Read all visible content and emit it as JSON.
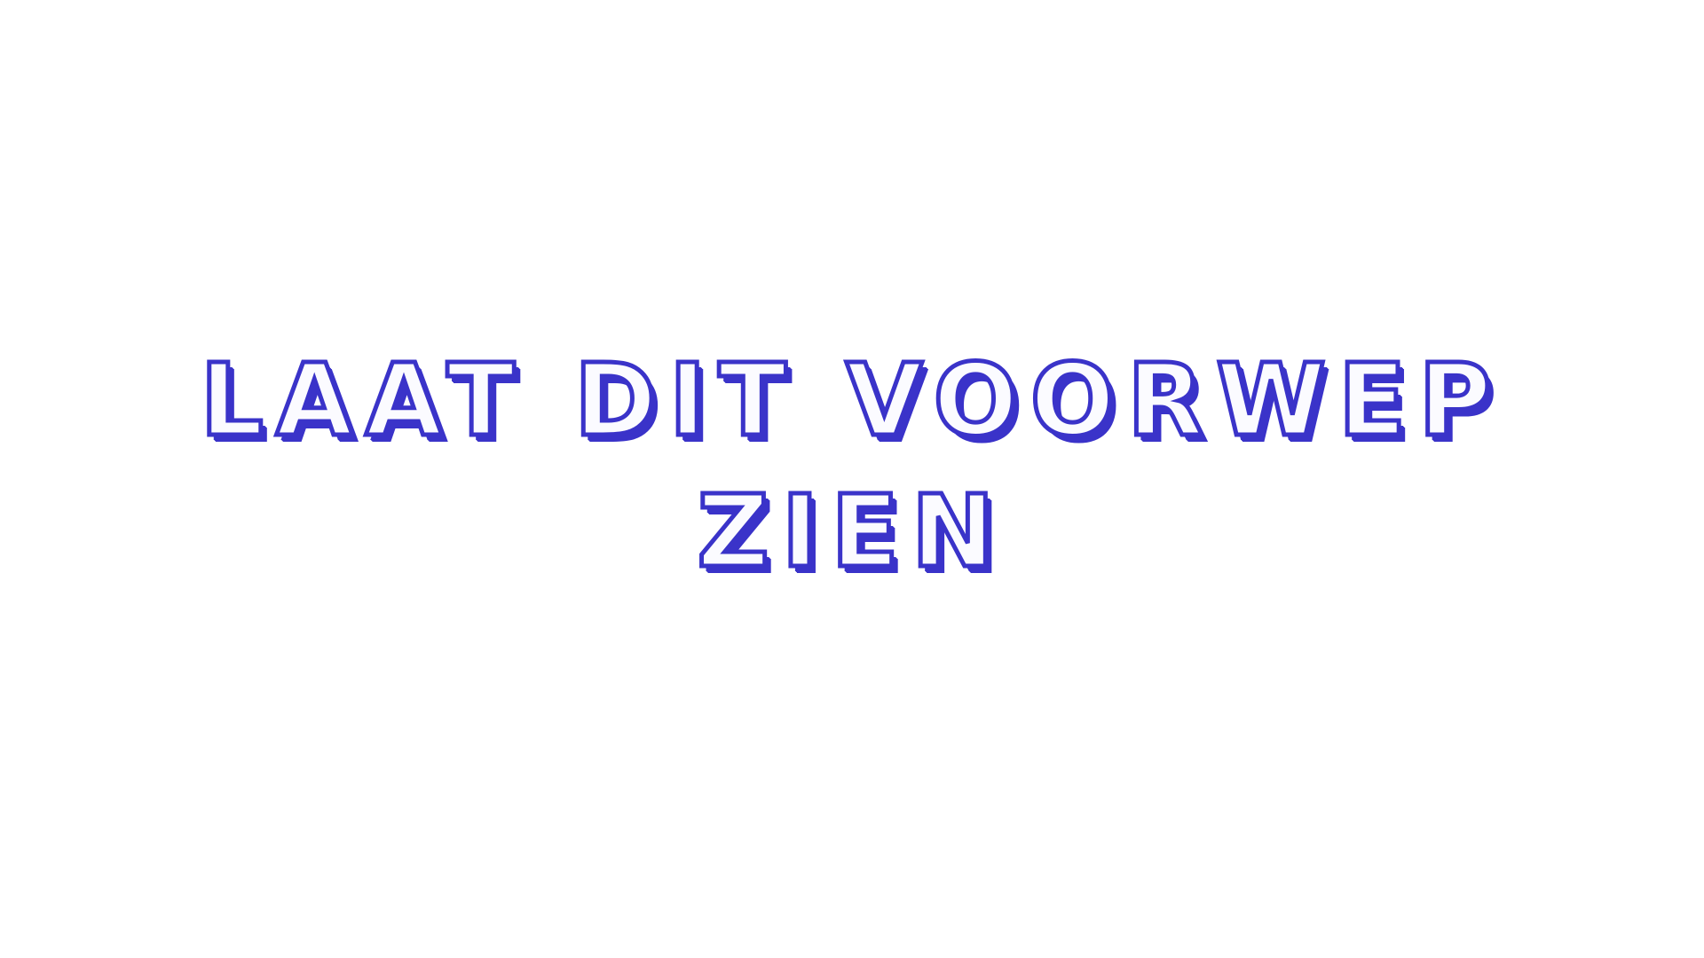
{
  "preview": {
    "line1": "laat dit voorwep",
    "line2": "zien"
  },
  "colors": {
    "background": "#ffffff",
    "text_outline": "#3a33c9",
    "text_fill": "#fbfbff"
  }
}
